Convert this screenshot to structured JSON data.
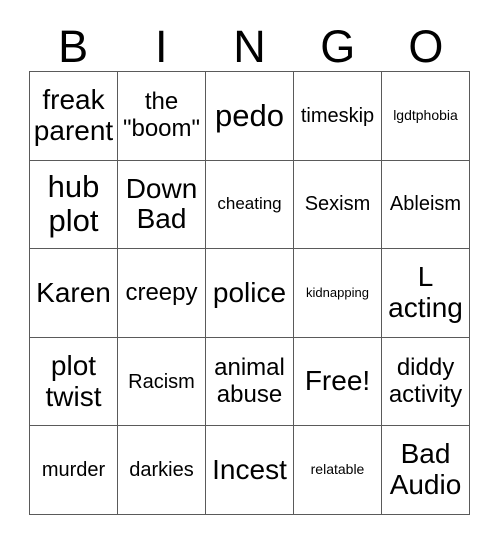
{
  "card": {
    "header_letters": [
      "B",
      "I",
      "N",
      "G",
      "O"
    ],
    "columns": 5,
    "rows": 5,
    "border_color": "#5a5a5a",
    "background_color": "#ffffff",
    "text_color": "#000000",
    "free_space_label": "Free!",
    "free_space_position": {
      "row": 4,
      "col": 3
    }
  },
  "cells": [
    {
      "text": "freak\nparent",
      "size": "lg"
    },
    {
      "text": "the\n\"boom\"",
      "size": "md"
    },
    {
      "text": "pedo",
      "size": "xl"
    },
    {
      "text": "timeskip",
      "size": "sm"
    },
    {
      "text": "lgdtphobia",
      "size": "xxs"
    },
    {
      "text": "hub\nplot",
      "size": "xl"
    },
    {
      "text": "Down\nBad",
      "size": "lg"
    },
    {
      "text": "cheating",
      "size": "xs"
    },
    {
      "text": "Sexism",
      "size": "sm"
    },
    {
      "text": "Ableism",
      "size": "sm"
    },
    {
      "text": "Karen",
      "size": "lg"
    },
    {
      "text": "creepy",
      "size": "md"
    },
    {
      "text": "police",
      "size": "lg"
    },
    {
      "text": "kidnapping",
      "size": "tiny"
    },
    {
      "text": "L\nacting",
      "size": "lg"
    },
    {
      "text": "plot\ntwist",
      "size": "lg"
    },
    {
      "text": "Racism",
      "size": "sm"
    },
    {
      "text": "animal\nabuse",
      "size": "md"
    },
    {
      "text": "Free!",
      "size": "lg"
    },
    {
      "text": "diddy\nactivity",
      "size": "md"
    },
    {
      "text": "murder",
      "size": "sm"
    },
    {
      "text": "darkies",
      "size": "sm"
    },
    {
      "text": "Incest",
      "size": "lg"
    },
    {
      "text": "relatable",
      "size": "xxs"
    },
    {
      "text": "Bad\nAudio",
      "size": "lg"
    }
  ]
}
